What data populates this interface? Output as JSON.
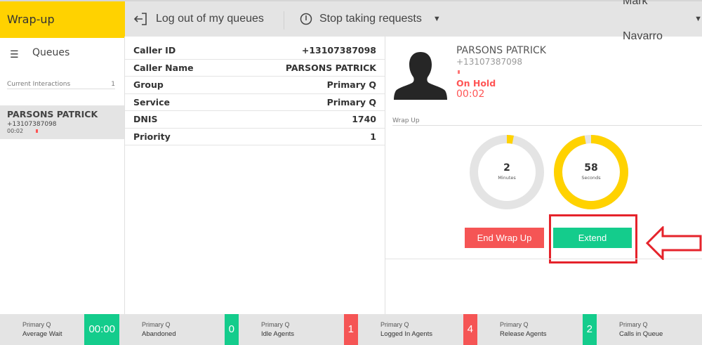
{
  "header": {
    "title": "Wrap-up",
    "logout_label": "Log out of my queues",
    "stop_label": "Stop taking requests",
    "user": "Mark Navarro",
    "colors": {
      "brand": "#ffd200"
    }
  },
  "sidebar": {
    "queues_label": "Queues",
    "current_label": "Current Interactions",
    "current_count": "1",
    "items": [
      {
        "name": "PARSONS PATRICK",
        "phone": "+13107387098",
        "time": "00:02"
      }
    ]
  },
  "details": {
    "rows": [
      {
        "label": "Caller ID",
        "value": "+13107387098"
      },
      {
        "label": "Caller Name",
        "value": "PARSONS PATRICK"
      },
      {
        "label": "Group",
        "value": "Primary Q"
      },
      {
        "label": "Service",
        "value": "Primary Q"
      },
      {
        "label": "DNIS",
        "value": "1740"
      },
      {
        "label": "Priority",
        "value": "1"
      }
    ]
  },
  "caller": {
    "name": "PARSONS PATRICK",
    "phone": "+13107387098",
    "status": "On Hold",
    "time": "00:02"
  },
  "wrapup": {
    "title": "Wrap Up",
    "minutes": {
      "value": "2",
      "label": "Minutes",
      "fill": 0.03
    },
    "seconds": {
      "value": "58",
      "label": "Seconds",
      "fill": 0.97
    },
    "end_label": "End Wrap Up",
    "extend_label": "Extend",
    "colors": {
      "ring": "#ffd200",
      "track": "#e4e4e4",
      "end": "#f55555",
      "extend": "#14cc8c",
      "highlight": "#e5232b"
    }
  },
  "footer": {
    "tiles": [
      {
        "queue": "Primary Q",
        "label": "Average Wait",
        "value": "00:00",
        "color": "#14cc8c"
      },
      {
        "queue": "Primary Q",
        "label": "Abandoned",
        "value": "0",
        "color": "#14cc8c"
      },
      {
        "queue": "Primary Q",
        "label": "Idle Agents",
        "value": "1",
        "color": "#f55555"
      },
      {
        "queue": "Primary Q",
        "label": "Logged In Agents",
        "value": "4",
        "color": "#f55555"
      },
      {
        "queue": "Primary Q",
        "label": "Release Agents",
        "value": "2",
        "color": "#14cc8c"
      },
      {
        "queue": "Primary Q",
        "label": "Calls in Queue",
        "value": "",
        "color": "#14cc8c"
      }
    ]
  }
}
